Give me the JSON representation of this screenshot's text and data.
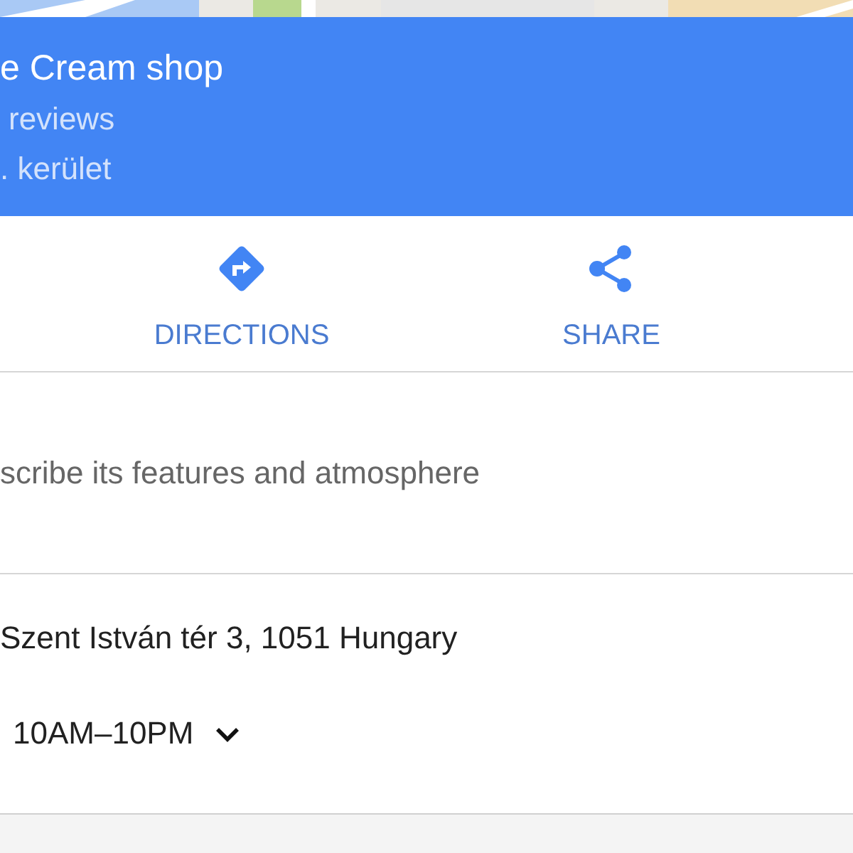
{
  "place": {
    "title": "e Cream shop",
    "reviews": "reviews",
    "area": ". kerület"
  },
  "actions": [
    {
      "kind": "directions",
      "label": "DIRECTIONS"
    },
    {
      "kind": "share",
      "label": "SHARE"
    }
  ],
  "description": {
    "text": "scribe its features and atmosphere"
  },
  "details": [
    {
      "kind": "address",
      "text": "Szent István tér 3, 1051 Hungary"
    },
    {
      "kind": "hours",
      "text": "10AM–10PM",
      "expanded": false
    }
  ]
}
